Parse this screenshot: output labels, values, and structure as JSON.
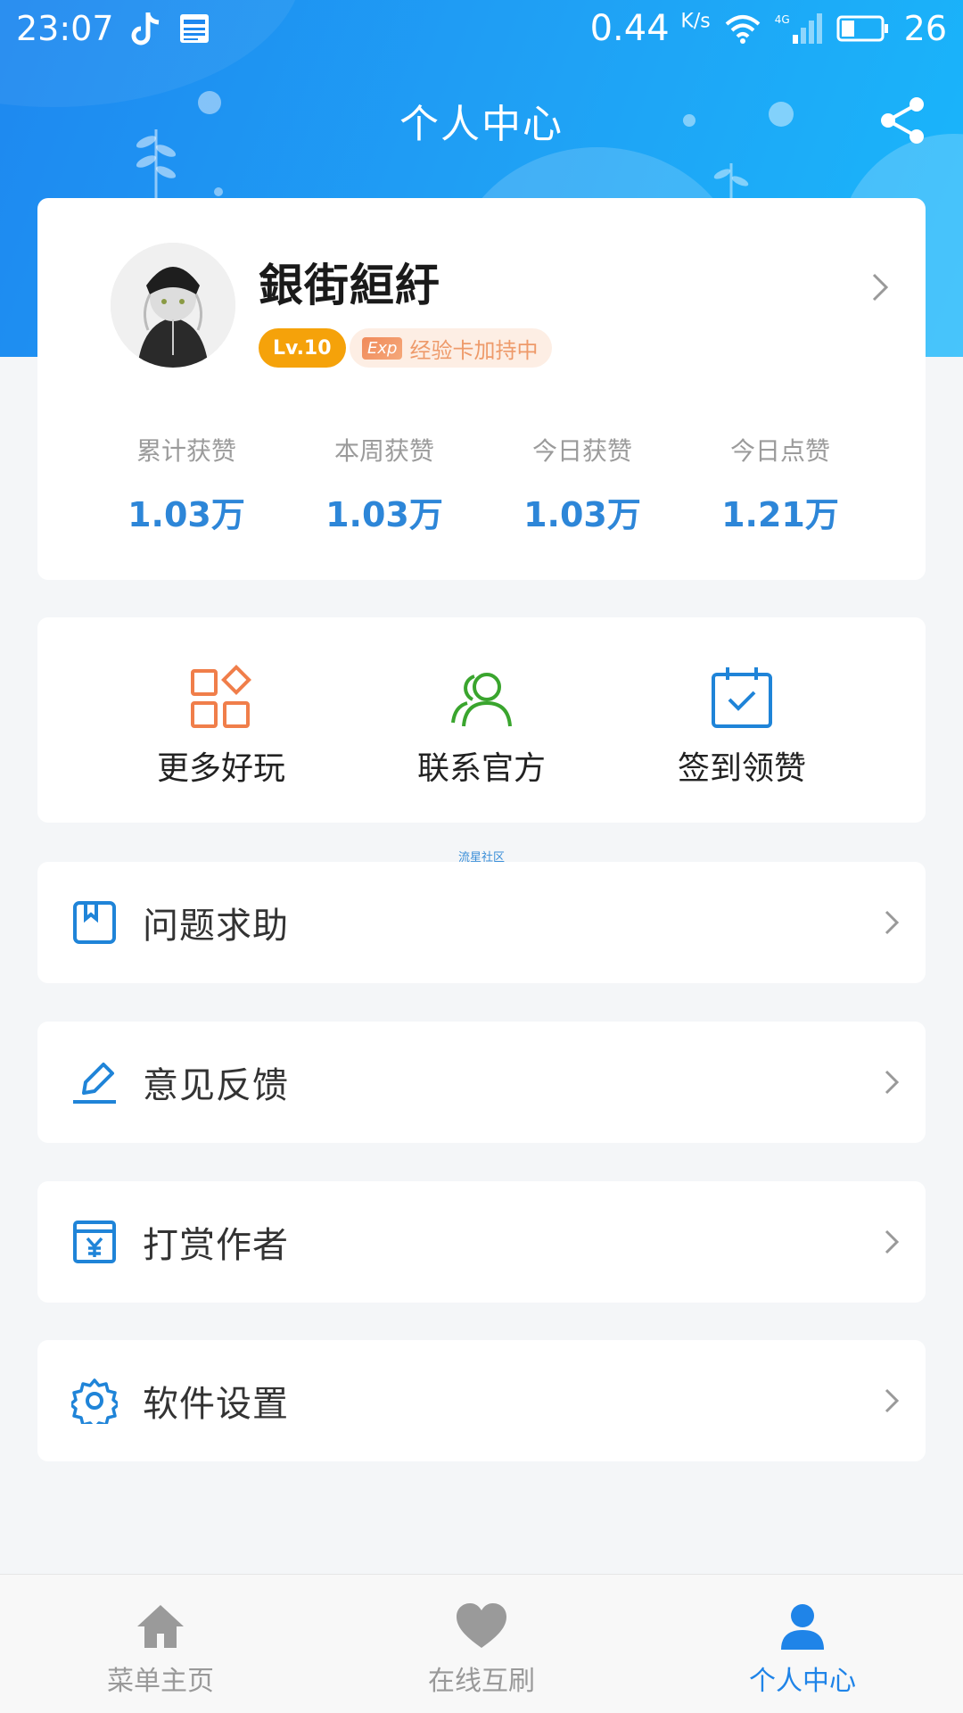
{
  "status_bar": {
    "time": "23:07",
    "network_speed": "0.44",
    "speed_unit": "K/s",
    "network_type": "4G",
    "battery": "26"
  },
  "header": {
    "title": "个人中心"
  },
  "profile": {
    "username": "銀街絙紆",
    "level": "Lv.10",
    "exp_tag": "Exp",
    "exp_text": "经验卡加持中"
  },
  "stats": [
    {
      "label": "累计获赞",
      "value": "1.03万"
    },
    {
      "label": "本周获赞",
      "value": "1.03万"
    },
    {
      "label": "今日获赞",
      "value": "1.03万"
    },
    {
      "label": "今日点赞",
      "value": "1.21万"
    }
  ],
  "actions": [
    {
      "label": "更多好玩",
      "icon": "apps-icon",
      "color": "#f07e4a"
    },
    {
      "label": "联系官方",
      "icon": "contacts-icon",
      "color": "#3aa52e"
    },
    {
      "label": "签到领赞",
      "icon": "calendar-check-icon",
      "color": "#1f84d8"
    }
  ],
  "watermark": "流星社区",
  "menu": [
    {
      "label": "问题求助",
      "icon": "bookmark-icon"
    },
    {
      "label": "意见反馈",
      "icon": "edit-icon"
    },
    {
      "label": "打赏作者",
      "icon": "yen-icon"
    },
    {
      "label": "软件设置",
      "icon": "gear-icon"
    }
  ],
  "bottom_nav": [
    {
      "label": "菜单主页",
      "icon": "home-icon",
      "active": false
    },
    {
      "label": "在线互刷",
      "icon": "heart-icon",
      "active": false
    },
    {
      "label": "个人中心",
      "icon": "person-icon",
      "active": true
    }
  ],
  "colors": {
    "primary": "#1f84e8",
    "stat_value": "#2d86d8",
    "level_badge": "#f5a20a"
  }
}
